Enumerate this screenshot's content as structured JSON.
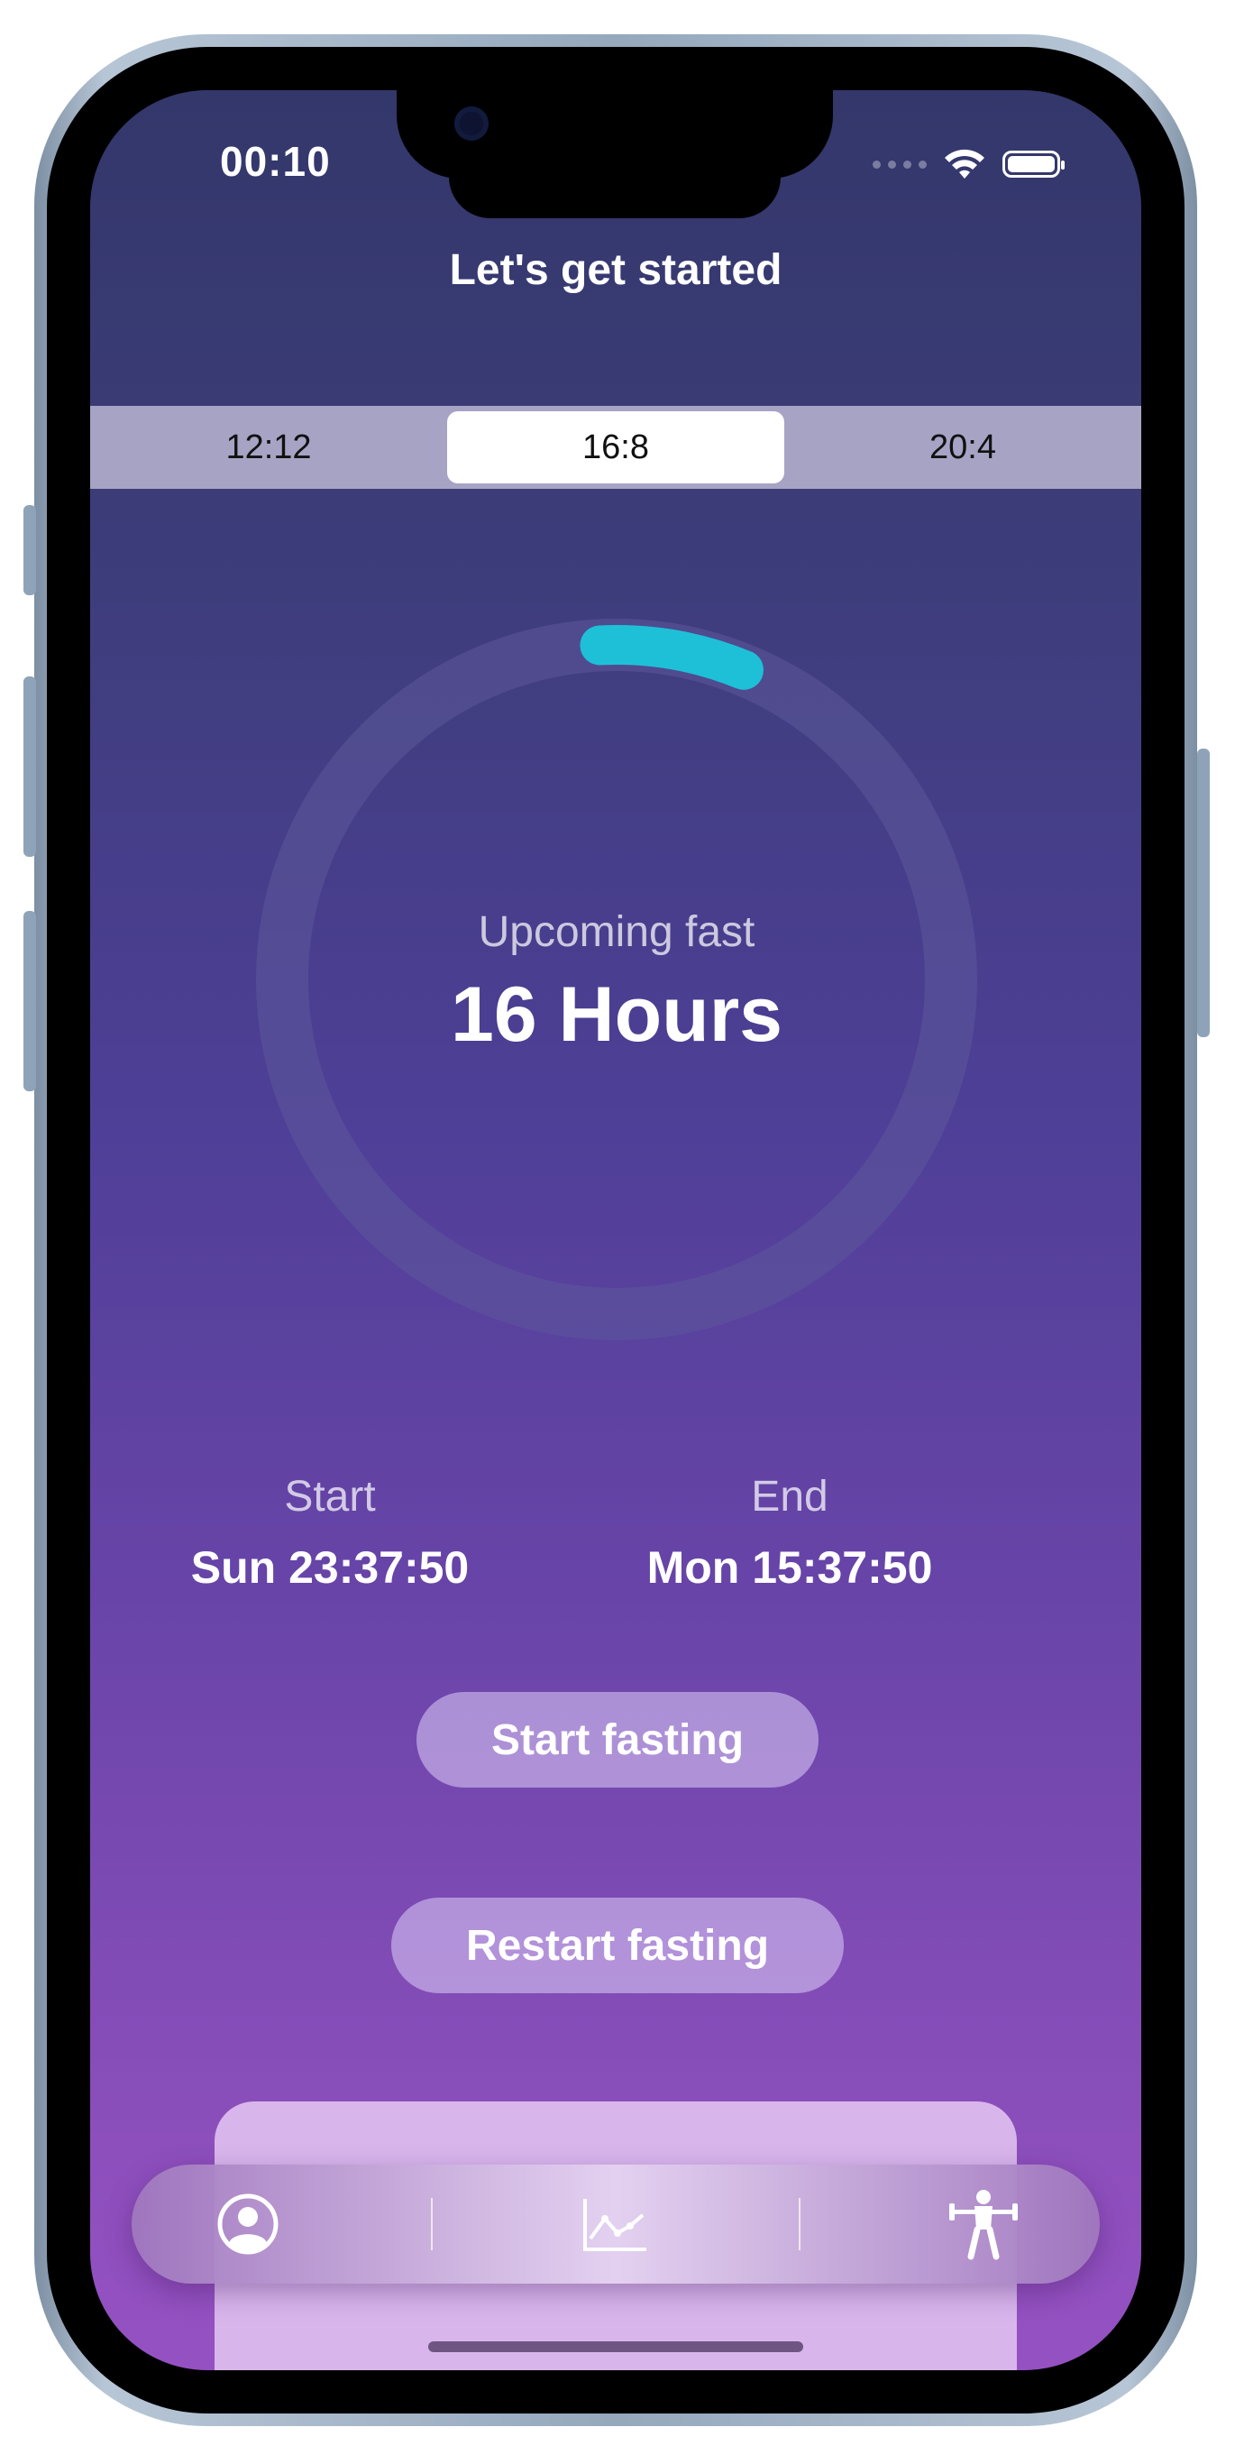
{
  "status_bar": {
    "time": "00:10"
  },
  "header": {
    "title": "Let's get started"
  },
  "plans": {
    "options": [
      "12:12",
      "16:8",
      "20:4"
    ],
    "selected": "16:8"
  },
  "fast": {
    "label": "Upcoming fast",
    "duration": "16 Hours",
    "progress_fraction": 0.07
  },
  "schedule": {
    "start_label": "Start",
    "start_value": "Sun 23:37:50",
    "end_label": "End",
    "end_value": "Mon 15:37:50"
  },
  "actions": {
    "start": "Start fasting",
    "restart": "Restart fasting"
  },
  "colors": {
    "progress": "#1ec0d8",
    "track": "#5c579a"
  },
  "tabs": [
    {
      "icon": "profile-icon"
    },
    {
      "icon": "chart-icon"
    },
    {
      "icon": "workout-icon"
    }
  ]
}
